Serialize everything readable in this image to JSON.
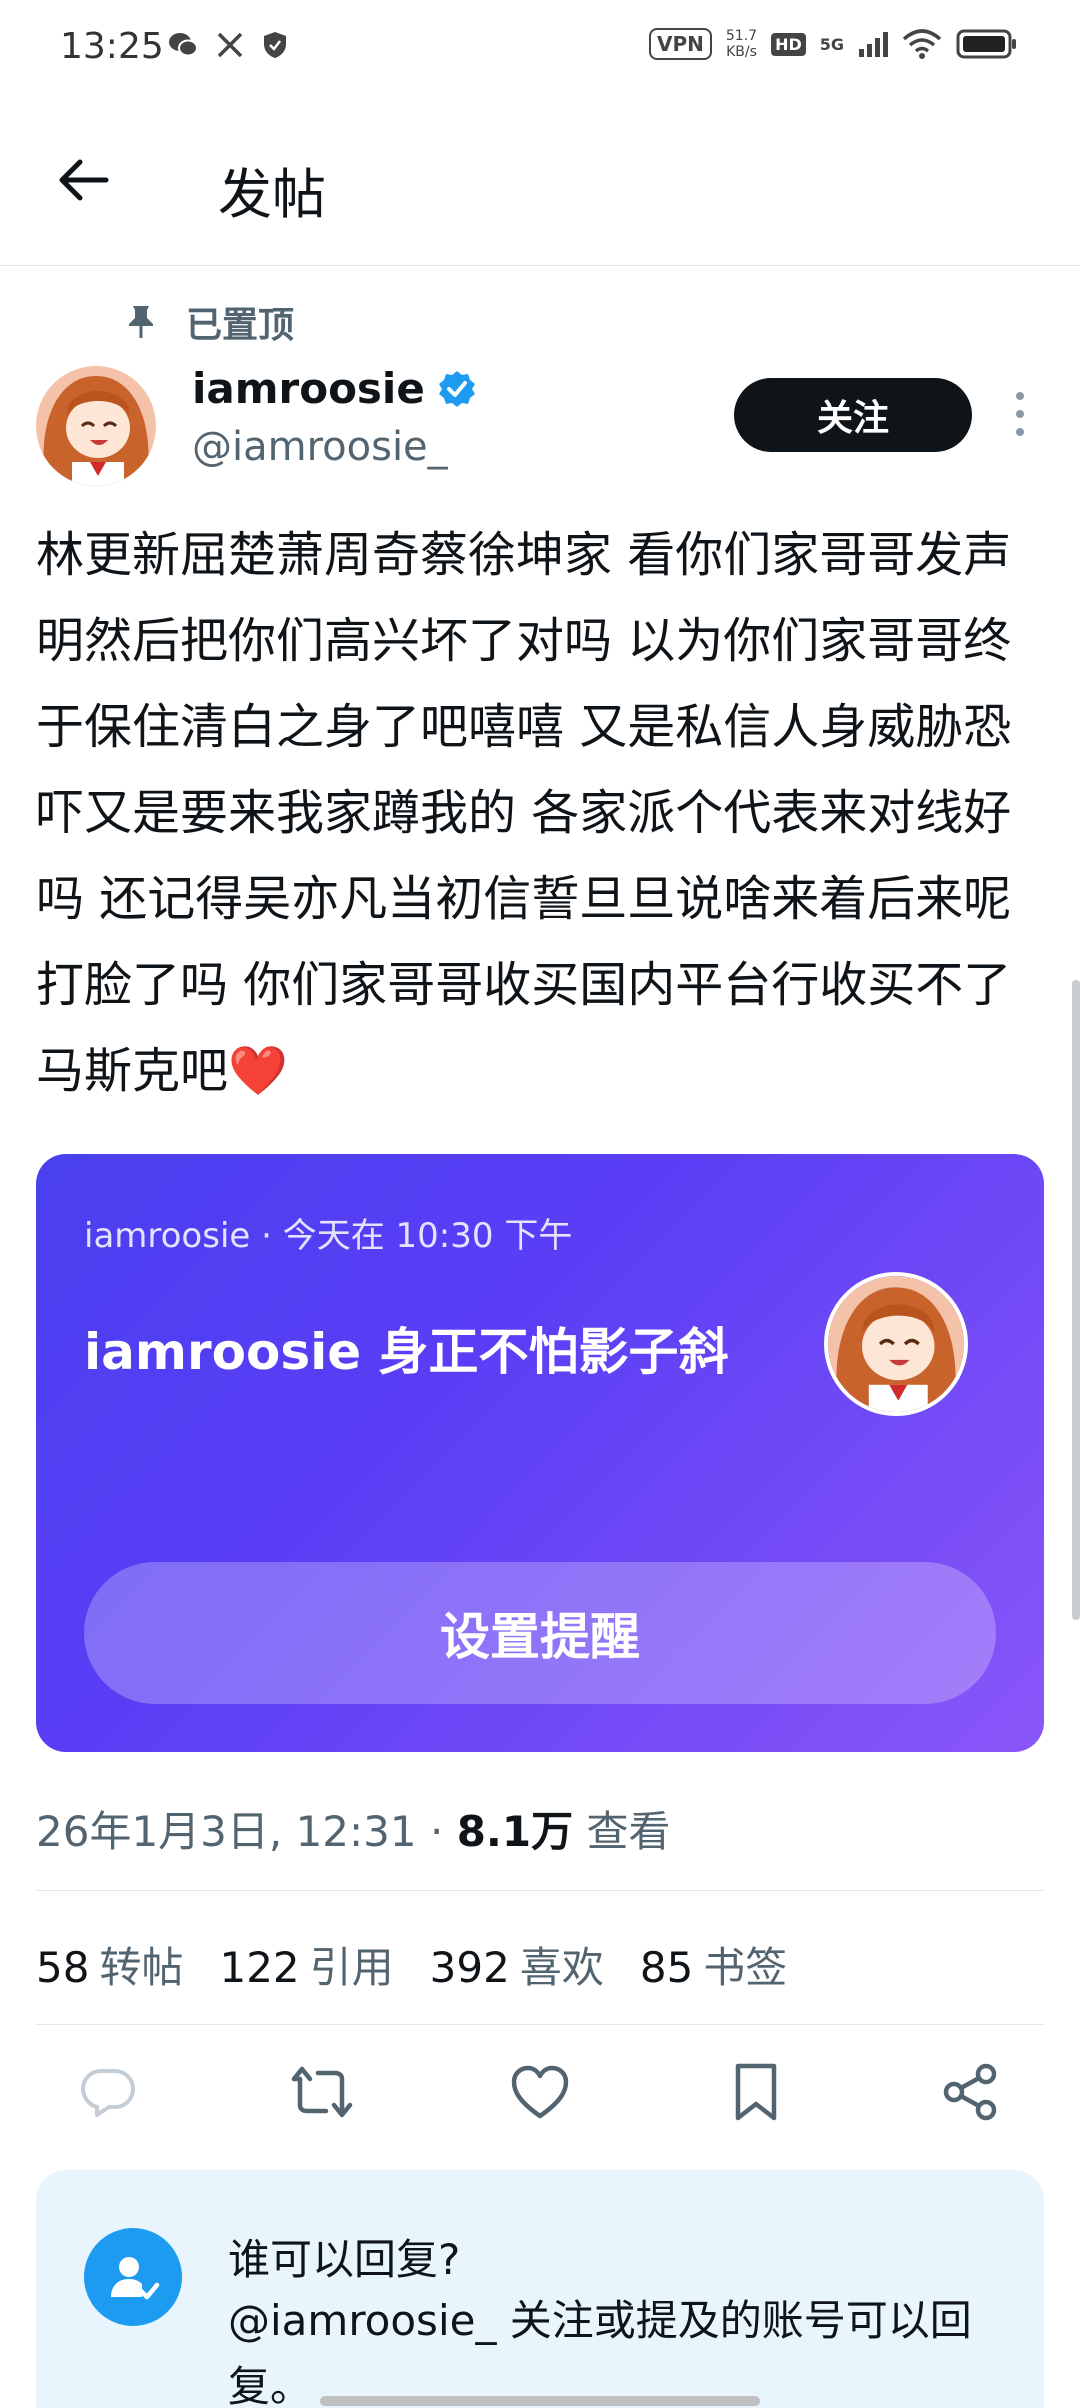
{
  "status_bar": {
    "time": "13:25",
    "vpn": "VPN",
    "speed_value": "51.7",
    "speed_unit": "KB/s",
    "hd": "HD",
    "network": "5G"
  },
  "header": {
    "title": "发帖"
  },
  "pinned": {
    "label": "已置顶"
  },
  "author": {
    "display_name": "iamroosie",
    "handle": "@iamroosie_",
    "verified": true
  },
  "follow_button": "关注",
  "tweet": {
    "text": "林更新屈楚萧周奇蔡徐坤家 看你们家哥哥发声明然后把你们高兴坏了对吗 以为你们家哥哥终于保住清白之身了吧嘻嘻 又是私信人身威胁恐吓又是要来我家蹲我的 各家派个代表来对线好吗 还记得吴亦凡当初信誓旦旦说啥来着后来呢打脸了吗 你们家哥哥收买国内平台行收买不了马斯克吧",
    "emoji": "❤️"
  },
  "card": {
    "meta": "iamroosie · 今天在 10:30 下午",
    "title": "iamroosie 身正不怕影子斜",
    "button": "设置提醒"
  },
  "timestamp": {
    "date": "26年1月3日, 12:31 · ",
    "views": "8.1万",
    "views_label": " 查看"
  },
  "stats": [
    {
      "num": "58",
      "label": "转帖"
    },
    {
      "num": "122",
      "label": "引用"
    },
    {
      "num": "392",
      "label": "喜欢"
    },
    {
      "num": "85",
      "label": "书签"
    }
  ],
  "actions": [
    "reply-icon",
    "retweet-icon",
    "like-icon",
    "bookmark-icon",
    "share-icon"
  ],
  "reply_settings": {
    "title": "谁可以回复?",
    "desc": "@iamroosie_ 关注或提及的账号可以回复。"
  },
  "colors": {
    "accent": "#1d9bf0",
    "card_start": "#4a40f0",
    "card_end": "#8a56f8",
    "text_secondary": "#536471"
  }
}
